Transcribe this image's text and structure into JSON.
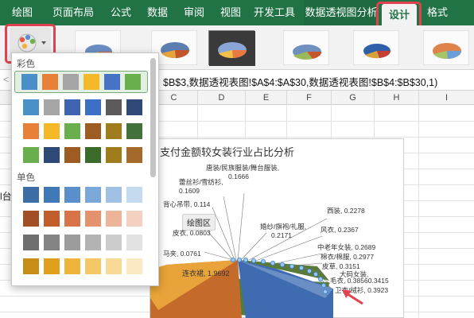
{
  "tabs": [
    {
      "label": "绘图"
    },
    {
      "label": "页面布局"
    },
    {
      "label": "公式"
    },
    {
      "label": "数据"
    },
    {
      "label": "审阅"
    },
    {
      "label": "视图"
    },
    {
      "label": "开发工具"
    },
    {
      "label": "数据透视图分析"
    },
    {
      "label": "设计",
      "active": true
    },
    {
      "label": "格式"
    }
  ],
  "ribbon": {
    "colors_button_label": "彩色"
  },
  "formula_bar": {
    "left_fragment": "<",
    "formula": "$B$3,数据透视表图!$A$4:$A$30,数据透视表图!$B$4:$B$30,1)"
  },
  "columns": [
    "C",
    "D",
    "E",
    "F",
    "G",
    "H",
    "I"
  ],
  "left_cell_text": "l台",
  "palette": {
    "section_colorful": "彩色",
    "section_mono": "单色",
    "colorful_rows": [
      [
        "#4a90c8",
        "#e8803a",
        "#a5a5a5",
        "#f5b827",
        "#4673c4",
        "#6aaf4d"
      ],
      [
        "#4a90c8",
        "#a5a5a5",
        "#3f64b1",
        "#3b70c5",
        "#5a5a5a",
        "#2e4878"
      ],
      [
        "#e8803a",
        "#f5b827",
        "#6aaf4d",
        "#9c5c22",
        "#a07c1d",
        "#43713a"
      ],
      [
        "#6aaf4d",
        "#2e4878",
        "#9c5c22",
        "#3a6b2a",
        "#a07c1d",
        "#a56a2b"
      ]
    ],
    "mono_rows": [
      [
        "#3c6ea5",
        "#3f79b8",
        "#5a8fcc",
        "#7aa8d8",
        "#a1c1e4",
        "#c5d9ef"
      ],
      [
        "#a24f25",
        "#c25e2c",
        "#d9744a",
        "#e4926e",
        "#eeb49a",
        "#f4d0c0"
      ],
      [
        "#6e6e6e",
        "#848484",
        "#9c9c9c",
        "#b3b3b3",
        "#cccccc",
        "#e2e2e2"
      ],
      [
        "#c68d17",
        "#e09f1d",
        "#f0b43a",
        "#f5c766",
        "#f8d996",
        "#fbe9c4"
      ]
    ],
    "colors": {
      "selected_bg": "#e3efe3"
    }
  },
  "chart": {
    "title": "支付金额较女装行业占比分析",
    "tooltip": "绘图区",
    "labels": [
      {
        "line1": "唐装/民族服装/舞台服装,",
        "line2": "0.1666"
      },
      {
        "line1": "蕾丝衫/雪纺衫,",
        "line2": "0.1609"
      },
      {
        "line1": "背心吊带, 0.114",
        "line2": ""
      },
      {
        "line1": "皮衣, 0.0803",
        "line2": ""
      },
      {
        "line1": "马夹, 0.0761",
        "line2": ""
      },
      {
        "line1": "连衣裙, 1.9692",
        "line2": ""
      },
      {
        "line1": "婚纱/旗袍/礼服,",
        "line2": "0.2171"
      },
      {
        "line1": "西装, 0.2278",
        "line2": ""
      },
      {
        "line1": "风衣, 0.2367",
        "line2": ""
      },
      {
        "line1": "中老年女装, 0.2689",
        "line2": ""
      },
      {
        "line1": "棉衣/棉服, 0.2977",
        "line2": ""
      },
      {
        "line1": "皮草, 0.3151",
        "line2": ""
      },
      {
        "line1": "大码女装,",
        "line2": ""
      },
      {
        "line1": "毛衣, 0.3856",
        "line2": "0.3415"
      },
      {
        "line1": "卫衣/绒衫, 0.3923",
        "line2": ""
      }
    ]
  },
  "highlight_color": "#e0424f",
  "accent_green": "#217346"
}
